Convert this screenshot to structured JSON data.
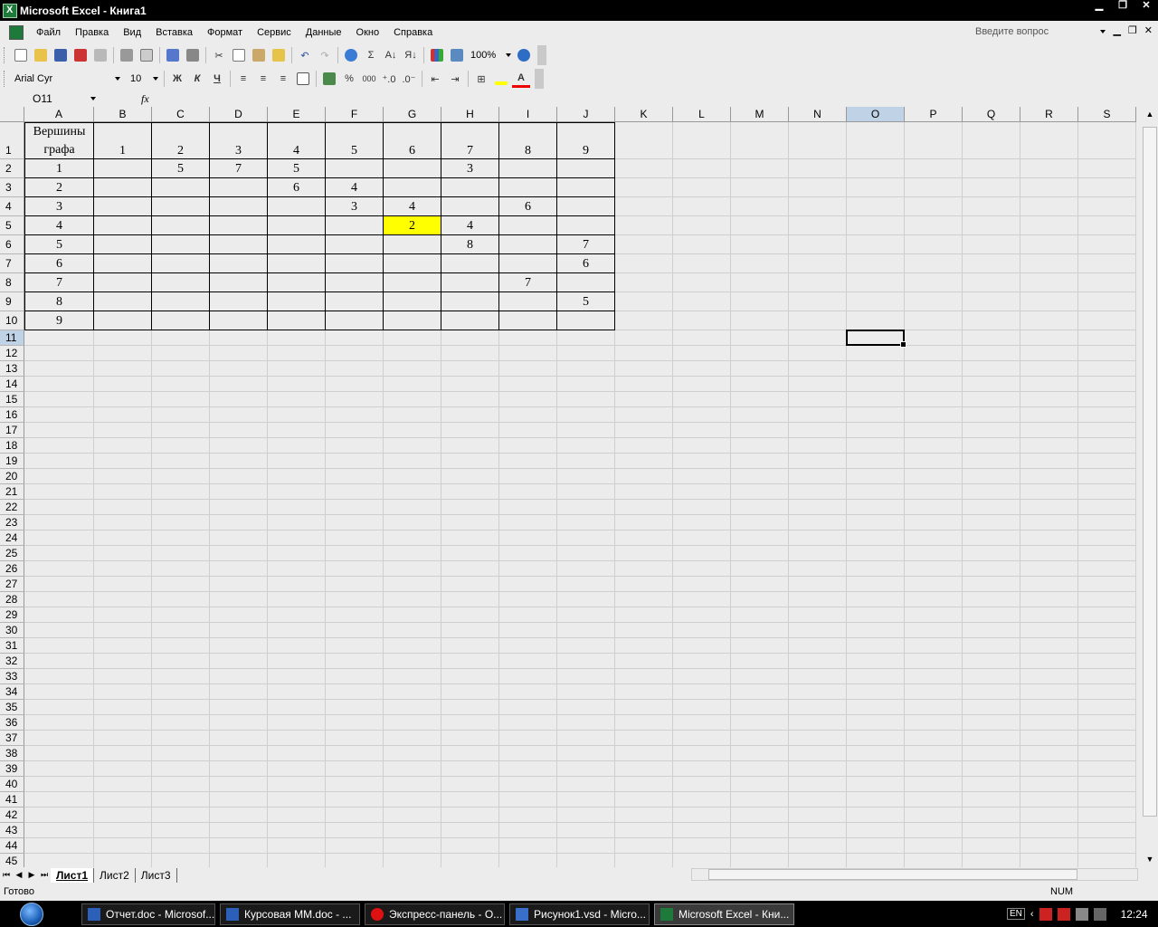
{
  "window": {
    "title": "Microsoft Excel - Книга1"
  },
  "menu": {
    "items": [
      "Файл",
      "Правка",
      "Вид",
      "Вставка",
      "Формат",
      "Сервис",
      "Данные",
      "Окно",
      "Справка"
    ],
    "help_placeholder": "Введите вопрос"
  },
  "toolbar": {
    "zoom": "100%",
    "font_name": "Arial Cyr",
    "font_size": "10",
    "bold": "Ж",
    "italic": "К",
    "underline": "Ч",
    "percent": "%",
    "thousands": "000",
    "autosum": "Σ"
  },
  "formula_bar": {
    "name_box": "O11",
    "fx": "fx",
    "content": ""
  },
  "sheet": {
    "columns": [
      "A",
      "B",
      "C",
      "D",
      "E",
      "F",
      "G",
      "H",
      "I",
      "J",
      "K",
      "L",
      "M",
      "N",
      "O",
      "P",
      "Q",
      "R",
      "S"
    ],
    "rows": [
      "1",
      "2",
      "3",
      "4",
      "5",
      "6",
      "7",
      "8",
      "9",
      "10",
      "11",
      "12",
      "13",
      "14",
      "15",
      "16",
      "17",
      "18",
      "19",
      "20",
      "21",
      "22",
      "23",
      "24",
      "25",
      "26",
      "27",
      "28",
      "29",
      "30",
      "31",
      "32",
      "33",
      "34",
      "35",
      "36",
      "37",
      "38",
      "39",
      "40",
      "41",
      "42",
      "43",
      "44",
      "45"
    ],
    "selected_column": "O",
    "selected_row": "11",
    "header_cell_line1": "Вершины",
    "header_cell_line2": "графа",
    "table": [
      [
        "",
        "1",
        "2",
        "3",
        "4",
        "5",
        "6",
        "7",
        "8",
        "9"
      ],
      [
        "1",
        "",
        "5",
        "7",
        "5",
        "",
        "",
        "3",
        "",
        ""
      ],
      [
        "2",
        "",
        "",
        "",
        "6",
        "4",
        "",
        "",
        "",
        ""
      ],
      [
        "3",
        "",
        "",
        "",
        "",
        "3",
        "4",
        "",
        "6",
        ""
      ],
      [
        "4",
        "",
        "",
        "",
        "",
        "",
        "2",
        "4",
        "",
        ""
      ],
      [
        "5",
        "",
        "",
        "",
        "",
        "",
        "",
        "8",
        "",
        "7"
      ],
      [
        "6",
        "",
        "",
        "",
        "",
        "",
        "",
        "",
        "",
        "6"
      ],
      [
        "7",
        "",
        "",
        "",
        "",
        "",
        "",
        "",
        "7",
        ""
      ],
      [
        "8",
        "",
        "",
        "",
        "",
        "",
        "",
        "",
        "",
        "5"
      ],
      [
        "9",
        "",
        "",
        "",
        "",
        "",
        "",
        "",
        "",
        ""
      ]
    ],
    "highlight_fill": "#ffff00"
  },
  "tabs": [
    "Лист1",
    "Лист2",
    "Лист3"
  ],
  "active_tab": "Лист1",
  "status": {
    "ready": "Готово",
    "num": "NUM"
  },
  "taskbar": {
    "items": [
      {
        "label": "Отчет.doc - Microsof...",
        "icon": "word-icon"
      },
      {
        "label": "Курсовая ММ.doc - ...",
        "icon": "word-icon"
      },
      {
        "label": "Экспресс-панель - О...",
        "icon": "opera-icon"
      },
      {
        "label": "Рисунок1.vsd - Micro...",
        "icon": "visio-icon"
      },
      {
        "label": "Microsoft Excel - Кни...",
        "icon": "excel-icon"
      }
    ],
    "lang": "EN",
    "clock": "12:24"
  }
}
